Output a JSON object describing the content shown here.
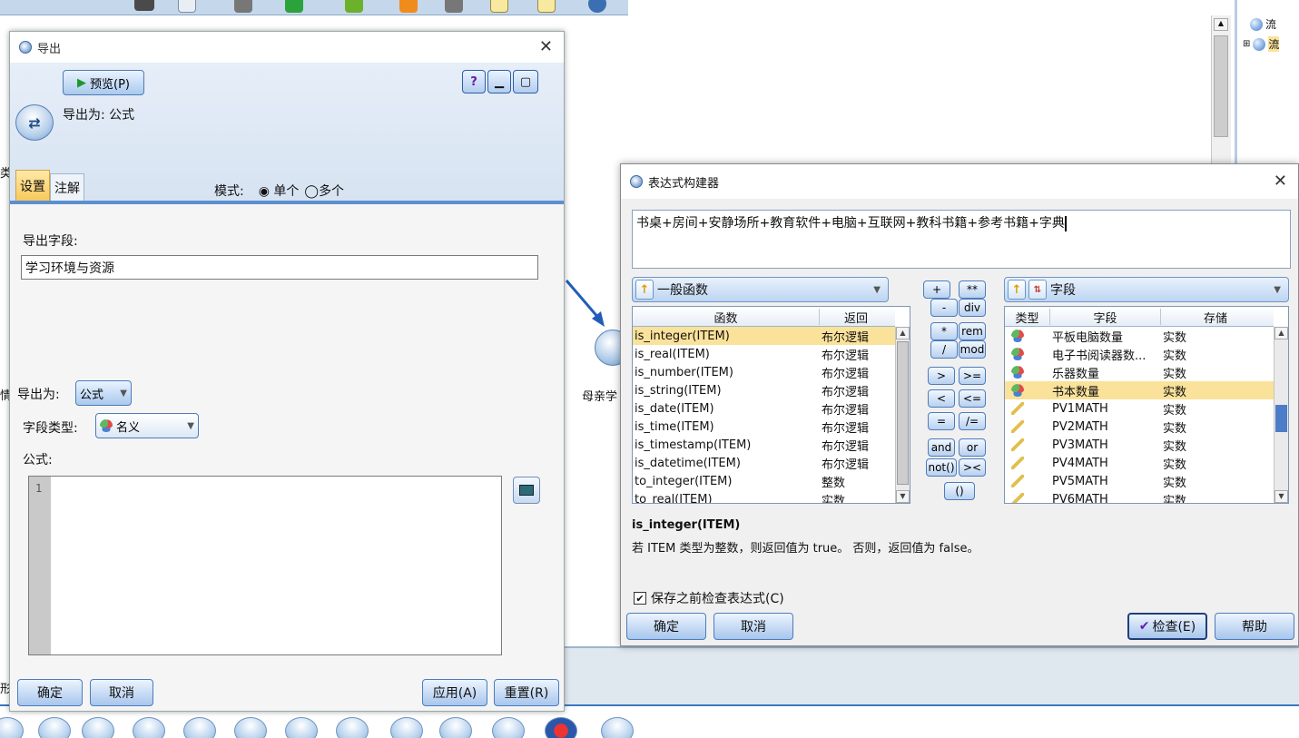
{
  "background": {
    "node_mother_label": "母亲学",
    "left_stub_1": "类",
    "left_stub_2": "情",
    "left_stub_3": "形",
    "tree_items": [
      "流",
      "流"
    ]
  },
  "export_dialog": {
    "title": "导出",
    "preview_label": "预览(P)",
    "export_as_header": "导出为: 公式",
    "tabs": [
      "设置",
      "注解"
    ],
    "mode_label": "模式:",
    "mode_options": [
      "单个",
      "多个"
    ],
    "mode_selected": "单个",
    "export_field_label": "导出字段:",
    "export_field_value": "学习环境与资源",
    "export_as_label": "导出为:",
    "export_as_value": "公式",
    "field_type_label": "字段类型:",
    "field_type_value": "名义",
    "formula_label": "公式:",
    "formula_line_number": "1",
    "buttons": {
      "ok": "确定",
      "cancel": "取消",
      "apply": "应用(A)",
      "reset": "重置(R)"
    }
  },
  "expr_builder": {
    "title": "表达式构建器",
    "expression": "书桌+房间+安静场所+教育软件+电脑+互联网+教科书籍+参考书籍+字典",
    "function_category": "一般函数",
    "functions_headers": [
      "函数",
      "返回"
    ],
    "functions": [
      {
        "name": "is_integer(ITEM)",
        "ret": "布尔逻辑",
        "selected": true
      },
      {
        "name": "is_real(ITEM)",
        "ret": "布尔逻辑"
      },
      {
        "name": "is_number(ITEM)",
        "ret": "布尔逻辑"
      },
      {
        "name": "is_string(ITEM)",
        "ret": "布尔逻辑"
      },
      {
        "name": "is_date(ITEM)",
        "ret": "布尔逻辑"
      },
      {
        "name": "is_time(ITEM)",
        "ret": "布尔逻辑"
      },
      {
        "name": "is_timestamp(ITEM)",
        "ret": "布尔逻辑"
      },
      {
        "name": "is_datetime(ITEM)",
        "ret": "布尔逻辑"
      },
      {
        "name": "to_integer(ITEM)",
        "ret": "整数"
      },
      {
        "name": "to_real(ITEM)",
        "ret": "实数"
      }
    ],
    "operators": [
      "+",
      "**",
      "-",
      "div",
      "*",
      "rem",
      "/",
      "mod",
      ">",
      ">=",
      "<",
      "<=",
      "=",
      "/=",
      "and",
      "or",
      "not()",
      "><",
      "()"
    ],
    "fields_category": "字段",
    "fields_headers": [
      "类型",
      "字段",
      "存储"
    ],
    "fields": [
      {
        "type": "set",
        "name": "平板电脑数量",
        "storage": "实数"
      },
      {
        "type": "set",
        "name": "电子书阅读器数...",
        "storage": "实数"
      },
      {
        "type": "set",
        "name": "乐器数量",
        "storage": "实数"
      },
      {
        "type": "set",
        "name": "书本数量",
        "storage": "实数",
        "selected": true
      },
      {
        "type": "ruler",
        "name": "PV1MATH",
        "storage": "实数"
      },
      {
        "type": "ruler",
        "name": "PV2MATH",
        "storage": "实数"
      },
      {
        "type": "ruler",
        "name": "PV3MATH",
        "storage": "实数"
      },
      {
        "type": "ruler",
        "name": "PV4MATH",
        "storage": "实数"
      },
      {
        "type": "ruler",
        "name": "PV5MATH",
        "storage": "实数"
      },
      {
        "type": "ruler",
        "name": "PV6MATH",
        "storage": "实数"
      }
    ],
    "desc_title": "is_integer(ITEM)",
    "desc_text": "若 ITEM 类型为整数，则返回值为 true。 否则，返回值为 false。",
    "check_before_save": "保存之前检查表达式(C)",
    "buttons": {
      "ok": "确定",
      "cancel": "取消",
      "check": "检查(E)",
      "help": "帮助"
    }
  }
}
